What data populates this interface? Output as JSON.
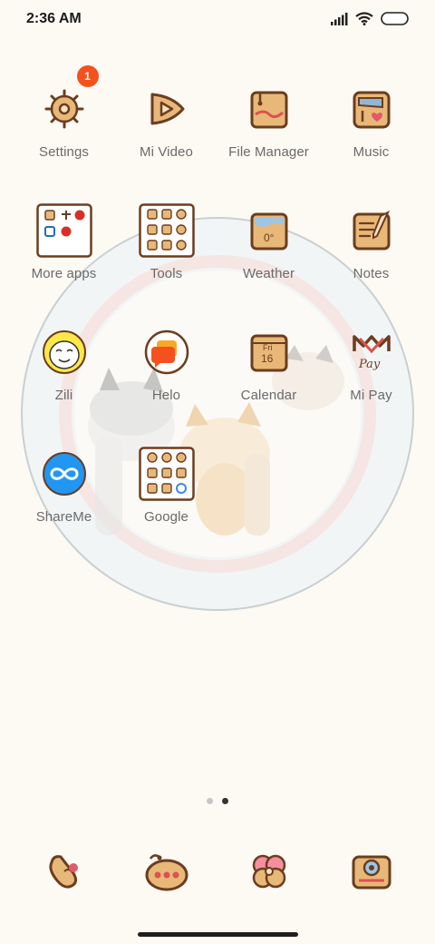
{
  "status_bar": {
    "time": "2:36 AM",
    "icons": [
      "signal-icon",
      "wifi-icon",
      "battery-icon"
    ]
  },
  "theme": {
    "icon_fill": "#e8b878",
    "icon_stroke": "#6b3d1f",
    "badge_color": "#f4511e",
    "label_color": "#6a6a6a"
  },
  "apps": [
    {
      "label": "Settings",
      "icon": "steering-wheel-icon",
      "badge": "1"
    },
    {
      "label": "Mi Video",
      "icon": "play-icon"
    },
    {
      "label": "File Manager",
      "icon": "folder-icon"
    },
    {
      "label": "Music",
      "icon": "music-icon"
    },
    {
      "label": "More apps",
      "icon": "folder-more-apps-icon"
    },
    {
      "label": "Tools",
      "icon": "folder-tools-icon"
    },
    {
      "label": "Weather",
      "icon": "weather-icon",
      "icon_text": "0°"
    },
    {
      "label": "Notes",
      "icon": "notes-icon"
    },
    {
      "label": "Zili",
      "icon": "zili-icon"
    },
    {
      "label": "Helo",
      "icon": "helo-icon"
    },
    {
      "label": "Calendar",
      "icon": "calendar-icon",
      "icon_day": "Fri",
      "icon_date": "16"
    },
    {
      "label": "Mi Pay",
      "icon": "mi-pay-icon",
      "icon_text": "Pay"
    },
    {
      "label": "ShareMe",
      "icon": "shareme-icon"
    },
    {
      "label": "Google",
      "icon": "folder-google-icon"
    }
  ],
  "page_indicator": {
    "pages": 2,
    "current": 2
  },
  "dock": [
    {
      "icon": "phone-icon"
    },
    {
      "icon": "messages-icon"
    },
    {
      "icon": "browser-icon"
    },
    {
      "icon": "camera-icon"
    }
  ]
}
